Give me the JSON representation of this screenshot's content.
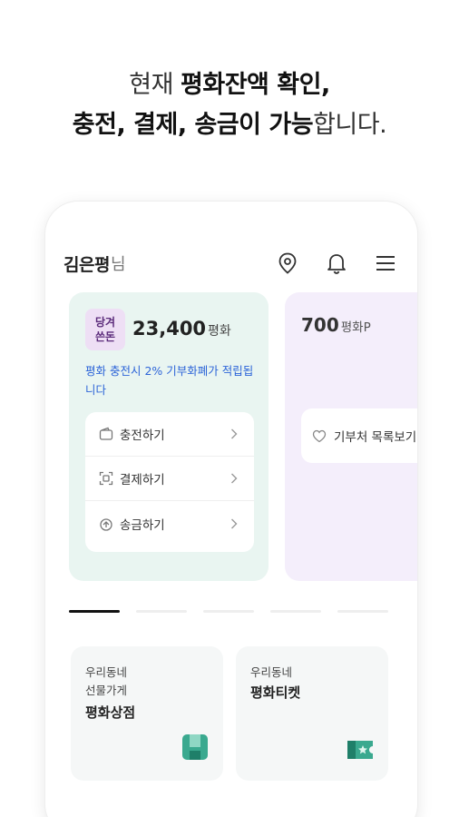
{
  "headline": {
    "line1_plain": "현재 ",
    "line1_bold": "평화잔액 확인,",
    "line2_bold": "충전, 결제, 송금이 가능",
    "line2_plain": "합니다."
  },
  "user": {
    "name": "김은평",
    "suffix": "님"
  },
  "top_icons": [
    "location-icon",
    "bell-icon",
    "menu-icon"
  ],
  "wallet_card": {
    "badge": "당겨\n쓴돈",
    "amount": "23,400",
    "unit": "평화",
    "notice": "평화 충전시 2% 기부화폐가 적립됩니다",
    "menu": [
      {
        "label": "충전하기",
        "icon": "wallet-icon"
      },
      {
        "label": "결제하기",
        "icon": "qr-icon"
      },
      {
        "label": "송금하기",
        "icon": "send-icon"
      }
    ]
  },
  "points_card": {
    "amount": "700",
    "unit": "평화P",
    "donate_label": "기부처 목록보기"
  },
  "pager": {
    "count": 5,
    "active": 0
  },
  "tiles": [
    {
      "line1": "우리동네",
      "line2": "선물가게",
      "title": "평화상점",
      "icon": "shop-icon"
    },
    {
      "line1": "우리동네",
      "title": "평화티켓",
      "icon": "ticket-icon"
    }
  ],
  "colors": {
    "wallet_bg": "#e9f5f1",
    "points_bg": "#f4eefb",
    "notice_blue": "#2c64d8",
    "brand_teal": "#2aa58a"
  }
}
